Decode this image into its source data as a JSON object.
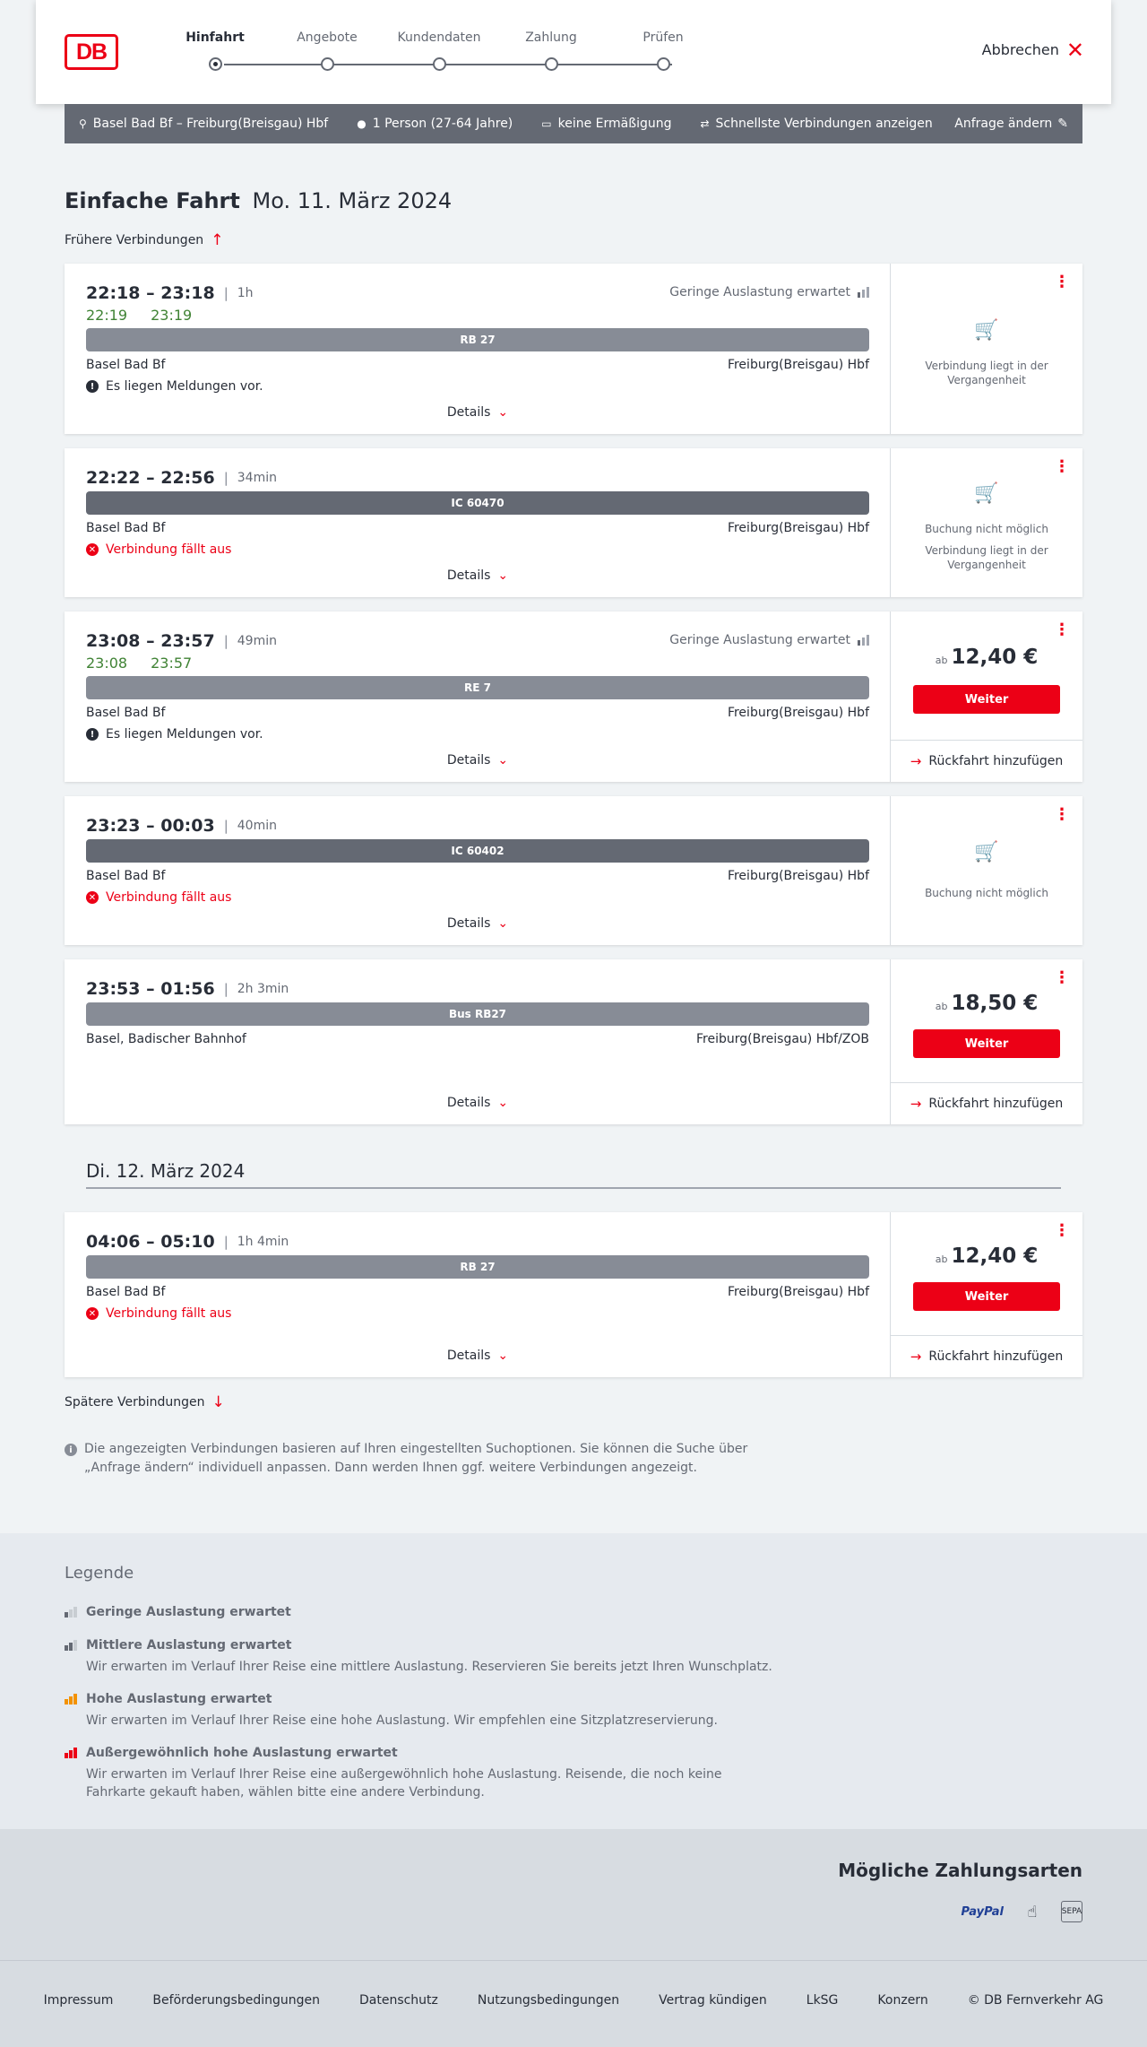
{
  "header": {
    "logo": "DB",
    "steps": [
      {
        "label": "Hinfahrt",
        "active": true
      },
      {
        "label": "Angebote",
        "active": false
      },
      {
        "label": "Kundendaten",
        "active": false
      },
      {
        "label": "Zahlung",
        "active": false
      },
      {
        "label": "Prüfen",
        "active": false
      }
    ],
    "cancel_label": "Abbrechen"
  },
  "search": {
    "route": "Basel Bad Bf – Freiburg(Breisgau) Hbf",
    "passengers": "1 Person (27-64 Jahre)",
    "discount": "keine Ermäßigung",
    "fastest": "Schnellste Verbindungen anzeigen",
    "change": "Anfrage ändern"
  },
  "title": {
    "type": "Einfache Fahrt",
    "date": "Mo. 11. März 2024"
  },
  "earlier_label": "Frühere Verbindungen",
  "later_label": "Spätere Verbindungen",
  "connections": [
    {
      "dep": "22:18",
      "arr": "23:18",
      "duration": "1h",
      "realtime_dep": "22:19",
      "realtime_arr": "23:19",
      "load": "Geringe Auslastung erwartet",
      "train": "RB 27",
      "from": "Basel Bad Bf",
      "to": "Freiburg(Breisgau) Hbf",
      "message": "Es liegen Meldungen vor.",
      "details": "Details",
      "status_text": "Verbindung liegt in der Vergangenheit"
    },
    {
      "dep": "22:22",
      "arr": "22:56",
      "duration": "34min",
      "train": "IC 60470",
      "from": "Basel Bad Bf",
      "to": "Freiburg(Breisgau) Hbf",
      "message": "Verbindung fällt aus",
      "details": "Details",
      "status_text": "Buchung nicht möglich",
      "status_text2": "Verbindung liegt in der Vergangenheit"
    },
    {
      "dep": "23:08",
      "arr": "23:57",
      "duration": "49min",
      "realtime_dep": "23:08",
      "realtime_arr": "23:57",
      "load": "Geringe Auslastung erwartet",
      "train": "RE 7",
      "from": "Basel Bad Bf",
      "to": "Freiburg(Breisgau) Hbf",
      "message": "Es liegen Meldungen vor.",
      "details": "Details",
      "price_prefix": "ab",
      "price": "12,40 €",
      "cta": "Weiter",
      "return": "Rückfahrt hinzufügen"
    },
    {
      "dep": "23:23",
      "arr": "00:03",
      "duration": "40min",
      "train": "IC 60402",
      "from": "Basel Bad Bf",
      "to": "Freiburg(Breisgau) Hbf",
      "message": "Verbindung fällt aus",
      "details": "Details",
      "status_text": "Buchung nicht möglich"
    },
    {
      "dep": "23:53",
      "arr": "01:56",
      "duration": "2h 3min",
      "train": "Bus RB27",
      "from": "Basel, Badischer Bahnhof",
      "to": "Freiburg(Breisgau) Hbf/ZOB",
      "details": "Details",
      "price_prefix": "ab",
      "price": "18,50 €",
      "cta": "Weiter",
      "return": "Rückfahrt hinzufügen"
    },
    {
      "dep": "04:06",
      "arr": "05:10",
      "duration": "1h 4min",
      "train": "RB 27",
      "from": "Basel Bad Bf",
      "to": "Freiburg(Breisgau) Hbf",
      "message": "Verbindung fällt aus",
      "details": "Details",
      "price_prefix": "ab",
      "price": "12,40 €",
      "cta": "Weiter",
      "return": "Rückfahrt hinzufügen"
    }
  ],
  "day_divider": "Di. 12. März 2024",
  "info_text": "Die angezeigten Verbindungen basieren auf Ihren eingestellten Suchoptionen. Sie können die Suche über „Anfrage ändern“ individuell anpassen. Dann werden Ihnen ggf. weitere Verbindungen angezeigt.",
  "legend": {
    "title": "Legende",
    "items": [
      {
        "title": "Geringe Auslastung erwartet",
        "desc": ""
      },
      {
        "title": "Mittlere Auslastung erwartet",
        "desc": "Wir erwarten im Verlauf Ihrer Reise eine mittlere Auslastung. Reservieren Sie bereits jetzt Ihren Wunschplatz."
      },
      {
        "title": "Hohe Auslastung erwartet",
        "desc": "Wir erwarten im Verlauf Ihrer Reise eine hohe Auslastung. Wir empfehlen eine Sitzplatzreservierung."
      },
      {
        "title": "Außergewöhnlich hohe Auslastung erwartet",
        "desc": "Wir erwarten im Verlauf Ihrer Reise eine außergewöhnlich hohe Auslastung. Reisende, die noch keine Fahrkarte gekauft haben, wählen bitte eine andere Verbindung."
      }
    ],
    "colors": {
      "low": "#a0a5af",
      "medium": "#646973",
      "high": "#f39200",
      "extreme": "#ec0016"
    }
  },
  "payment": {
    "title": "Mögliche Zahlungsarten",
    "paypal": "PayPal",
    "sepa": "SEPA"
  },
  "footer": {
    "links": [
      "Impressum",
      "Beförderungsbedingungen",
      "Datenschutz",
      "Nutzungsbedingungen",
      "Vertrag kündigen",
      "LkSG",
      "Konzern",
      "© DB Fernverkehr AG"
    ]
  },
  "colors": {
    "accent": "#ec0016",
    "realtime": "#408335",
    "bar": "#646973"
  }
}
